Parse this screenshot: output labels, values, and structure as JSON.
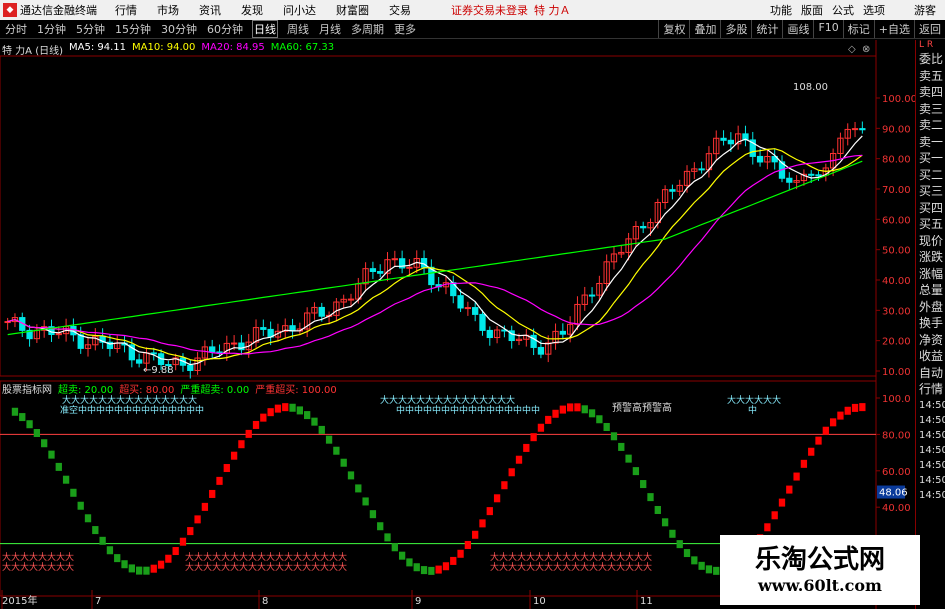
{
  "topbar": {
    "app_name": "通达信金融终端",
    "menus": [
      "行情",
      "市场",
      "资讯",
      "发现",
      "问小达",
      "财富圈",
      "交易"
    ],
    "notice": "证券交易未登录",
    "stock_title": "特 力Ａ",
    "right_menus": [
      "功能",
      "版面",
      "公式",
      "选项"
    ],
    "guest": "游客"
  },
  "periodbar": {
    "periods": [
      "分时",
      "1分钟",
      "5分钟",
      "15分钟",
      "30分钟",
      "60分钟",
      "日线",
      "周线",
      "月线",
      "多周期",
      "更多"
    ],
    "active": "日线",
    "tools": [
      "复权",
      "叠加",
      "多股",
      "统计",
      "画线",
      "F10",
      "标记",
      "+自选",
      "返回"
    ]
  },
  "main_legend": {
    "title": "特 力A (日线)",
    "ma5": "MA5: 94.11",
    "ma10": "MA10: 94.00",
    "ma20": "MA20: 84.95",
    "ma60": "MA60: 67.33"
  },
  "indicator_legend": {
    "name": "股票指标网",
    "oversold": "超卖: 20.00",
    "overbought": "超买: 80.00",
    "severe_oversold": "严重超卖: 0.00",
    "severe_overbought": "严重超买: 100.00"
  },
  "price_axis": [
    "100.00",
    "90.00",
    "80.00",
    "70.00",
    "60.00",
    "50.00",
    "40.00",
    "30.00",
    "20.00",
    "10.00"
  ],
  "ind_axis": [
    "100.0",
    "80.00",
    "60.00",
    "40.00",
    "20.00"
  ],
  "ind_current": "48.06",
  "annotations": {
    "high": "108.00",
    "low": "9.88"
  },
  "signals": {
    "strip": "大大大大大大大大大大大大大大大大大大",
    "jinglu": "准空",
    "topword": "预警高",
    "mid": "中"
  },
  "x_labels": [
    "2015年",
    "7",
    "8",
    "9",
    "10",
    "11"
  ],
  "side_panel": {
    "header": "L R",
    "items": [
      "委比",
      "卖五",
      "卖四",
      "卖三",
      "卖二",
      "卖一",
      "买一",
      "买二",
      "买三",
      "买四",
      "买五",
      "现价",
      "涨跌",
      "涨幅",
      "总量",
      "外盘",
      "换手",
      "净资",
      "收益",
      "自动",
      "行情",
      "14:50",
      "14:50",
      "14:50",
      "14:50",
      "14:50",
      "14:50",
      "14:50"
    ]
  },
  "watermark": {
    "line1": "乐淘公式网",
    "line2": "www.60lt.com"
  },
  "colors": {
    "up": "#ff3232",
    "down": "#00e8e8",
    "ma5": "#ffffff",
    "ma10": "#ffff00",
    "ma20": "#ff00ff",
    "ma60": "#00ff00",
    "bar_up": "#ff0000",
    "bar_down": "#1a9e1a"
  }
}
